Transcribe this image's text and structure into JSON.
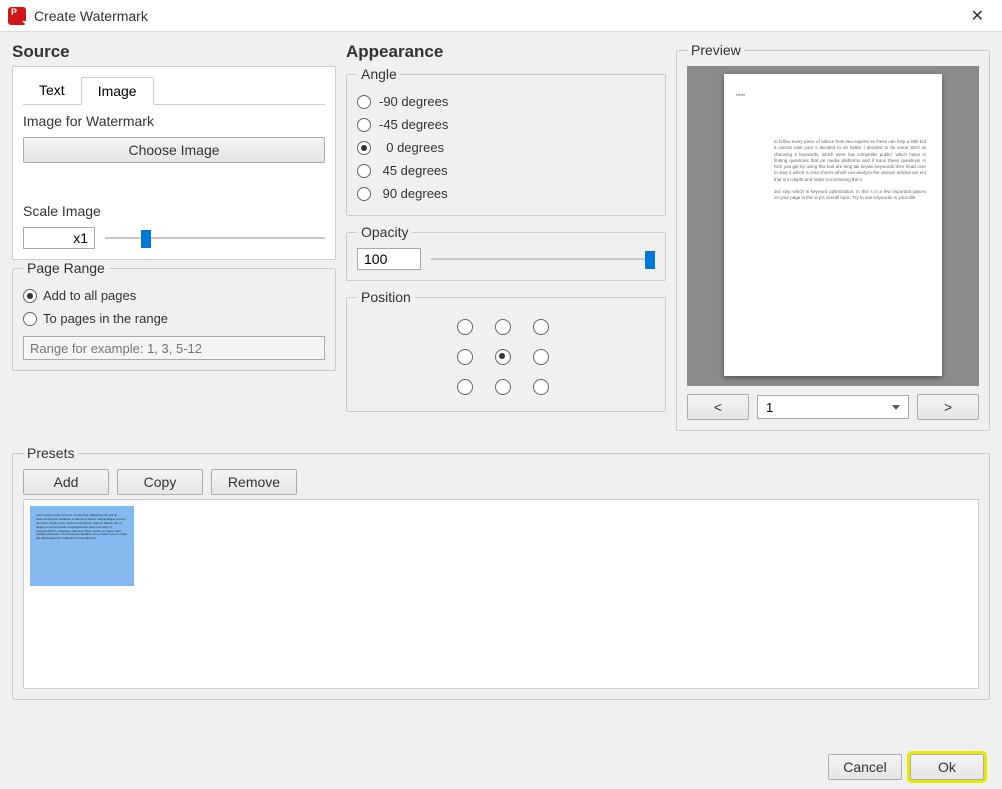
{
  "titlebar": {
    "title": "Create Watermark"
  },
  "source": {
    "heading": "Source",
    "tabs": {
      "text": "Text",
      "image": "Image"
    },
    "image_label": "Image for Watermark",
    "choose_image": "Choose Image",
    "scale_label": "Scale Image",
    "scale_value": "x1"
  },
  "page_range": {
    "legend": "Page Range",
    "opt_all": "Add to all pages",
    "opt_range": "To pages in the range",
    "placeholder": "Range for example: 1, 3, 5-12"
  },
  "appearance": {
    "heading": "Appearance",
    "angle": {
      "legend": "Angle",
      "neg90": "-90 degrees",
      "neg45": "-45 degrees",
      "zero": "  0 degrees",
      "pos45": " 45 degrees",
      "pos90": " 90 degrees"
    },
    "opacity": {
      "legend": "Opacity",
      "value": "100"
    },
    "position": {
      "legend": "Position"
    }
  },
  "preview": {
    "legend": "Preview",
    "prev": "<",
    "next": ">",
    "page": "1",
    "sample_title": "Hello",
    "sample_para1": "to follow every piece of advice from seo experts as these can help a little but it cannot rank your s decided to do better I decided to do some SEO wi choosing 4 keywords, which were low competitiv public\" which helps in finding questions that pe media platforms and if turns these questions in hich you get by using this tool are long tail keywo keywords then head over to step 2 which is crea churns which can analyze the various articles am ent that is in-depth and helps in increasing the ti",
    "sample_para2": "3rd step which is keyword optimization. In this s in a few important places on your page in this w p's overall topic. Try to use keywords in your title"
  },
  "presets": {
    "legend": "Presets",
    "add": "Add",
    "copy": "Copy",
    "remove": "Remove",
    "thumb_text": "Lorem ipsum dolor sit amet consectetur adipiscing elit sed do eiusmod tempor incididunt ut labore et dolore magna aliqua ut enim ad minim veniam quis nostrud exercitation ullamco laboris nisi ut aliquip ex ea commodo consequat duis aute irure dolor in reprehenderit in voluptate velit esse cillum dolore eu fugiat nulla pariatur excepteur sint occaecat cupidatat non proident sunt in culpa qui officia deserunt mollit anim id est laborum"
  },
  "footer": {
    "cancel": "Cancel",
    "ok": "Ok"
  }
}
